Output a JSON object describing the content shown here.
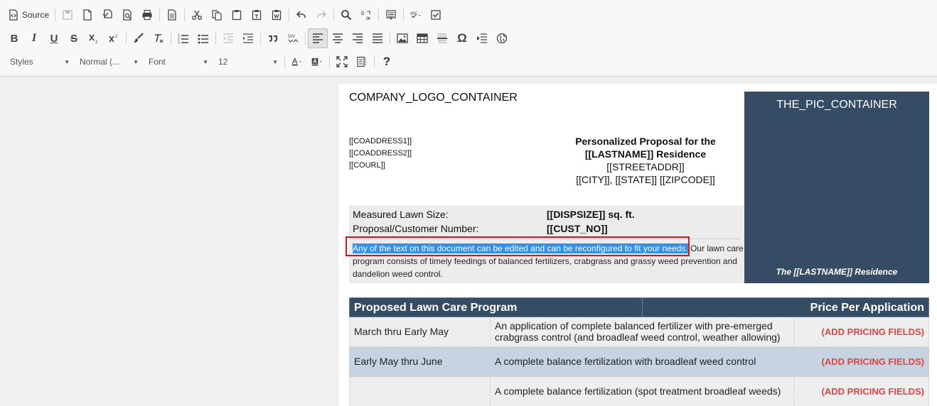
{
  "toolbar": {
    "source_label": "Source",
    "styles_label": "Styles",
    "format_label": "Normal (...",
    "font_label": "Font",
    "size_label": "12",
    "help_label": "?"
  },
  "document": {
    "logo_placeholder": "COMPANY_LOGO_CONTAINER",
    "coaddress1": "[[COADDRESS1]]",
    "coaddress2": "[[COADDRESS2]]",
    "courl": "[[COURL]]",
    "proposal_line1": "Personalized Proposal for the",
    "proposal_line2": "[[LASTNAME]] Residence",
    "street": "[[STREETADDR]]",
    "city_state_zip": "[[CITY]], [[STATE]] [[ZIPCODE]]",
    "pic_placeholder": "THE_PIC_CONTAINER",
    "pic_caption": "The [[LASTNAME]] Residence",
    "lawn_size_label": "Measured Lawn Size:",
    "lawn_size_value": "[[DISPSIZE]] sq. ft.",
    "customer_label": "Proposal/Customer Number:",
    "customer_value": "[[CUST_NO]]",
    "selected_text": "Any of the text on this document can be edited and can be reconfigured to fit your needs.",
    "paragraph_rest": " Our lawn care program consists of timely feedings of balanced fertilizers, crabgrass and grassy weed prevention and dandelion weed control."
  },
  "pricing_table": {
    "header_left": "Proposed Lawn Care Program",
    "header_right": "Price Per Application",
    "rows": [
      {
        "period": "March thru Early May",
        "description": "An application of complete balanced fertilizer with pre-emerged crabgrass control (and broadleaf weed control, weather allowing)",
        "price": "(ADD PRICING FIELDS)"
      },
      {
        "period": "Early May thru June",
        "description": "A complete balance fertilization with broadleaf weed control",
        "price": "(ADD PRICING FIELDS)"
      },
      {
        "period": "",
        "description": "A complete balance fertilization (spot treatment broadleaf weeds)",
        "price": "(ADD PRICING FIELDS)"
      }
    ]
  },
  "colors": {
    "header_bg": "#354c64",
    "alt_row_bg": "#c6d3e0",
    "price_red": "#e04545",
    "selection_blue": "#3390e6",
    "highlight_box_red": "#d01818"
  }
}
